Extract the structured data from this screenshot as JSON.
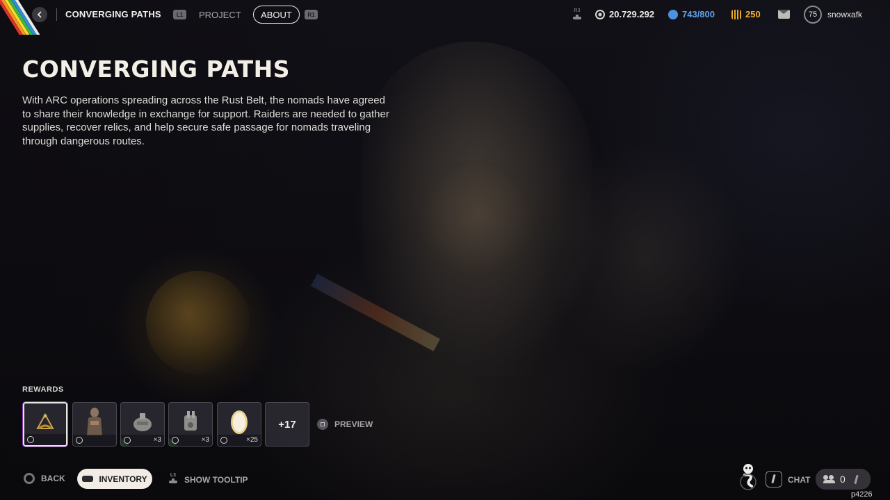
{
  "header": {
    "title": "CONVERGING PATHS",
    "left_shoulder": "L1",
    "right_shoulder": "R1",
    "tabs": [
      {
        "label": "PROJECT",
        "active": false
      },
      {
        "label": "ABOUT",
        "active": true
      }
    ],
    "r3_label": "R3",
    "currencies": {
      "coins": "20.729.292",
      "blue": "743/800",
      "gold": "250"
    },
    "player_level": "75",
    "username": "snowxafk"
  },
  "main": {
    "title": "CONVERGING PATHS",
    "description": "With ARC operations spreading across the Rust Belt, the nomads have agreed to share their knowledge in exchange for support. Raiders are needed to gather supplies, recover relics, and help secure safe passage for nomads traveling through dangerous routes."
  },
  "rewards": {
    "label": "REWARDS",
    "items": [
      {
        "icon": "sextant-icon",
        "quantity": ""
      },
      {
        "icon": "nomad-outfit-icon",
        "quantity": ""
      },
      {
        "icon": "grenade-icon",
        "quantity": "×3"
      },
      {
        "icon": "device-icon",
        "quantity": "×3"
      },
      {
        "icon": "egg-icon",
        "quantity": "×25"
      }
    ],
    "more": "+17",
    "preview_label": "PREVIEW"
  },
  "footer": {
    "back_label": "BACK",
    "inventory_label": "INVENTORY",
    "l3_label": "L3",
    "tooltip_label": "SHOW TOOLTIP",
    "chat_label": "CHAT",
    "friends_count": "0",
    "build_id": "p4226"
  },
  "colors": {
    "accent_blue": "#5fa3ea",
    "accent_gold": "#f0b22e",
    "rarity_green": "#2fa84e",
    "selected_purple": "#8a3fc2",
    "pill_bg": "#f1ede4"
  }
}
